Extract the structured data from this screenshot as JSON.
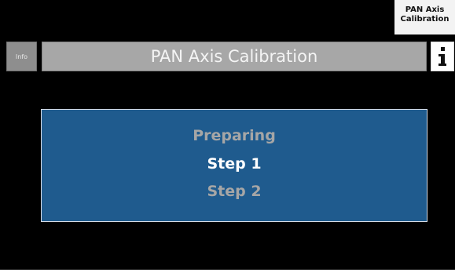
{
  "header": {
    "tab_label_line1": "PAN Axis",
    "tab_label_line2": "Calibration",
    "info_button_label": "Info",
    "title": "PAN Axis Calibration"
  },
  "main": {
    "steps": [
      {
        "label": "Preparing",
        "state": "inactive"
      },
      {
        "label": "Step 1",
        "state": "active"
      },
      {
        "label": "Step 2",
        "state": "inactive"
      }
    ]
  },
  "icons": {
    "info_icon": "info-icon"
  },
  "colors": {
    "background": "#000000",
    "title_bar": "#a7a7a7",
    "panel": "#1f5b8e",
    "active_text": "#ffffff",
    "inactive_text": "#a6a6a6"
  }
}
